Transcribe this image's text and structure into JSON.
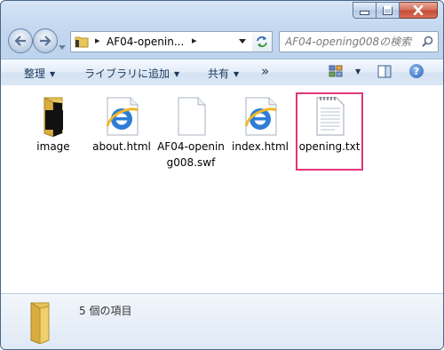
{
  "window": {
    "buttons": [
      "minimize-button",
      "maximize-button",
      "close-button"
    ]
  },
  "nav": {
    "breadcrumb_arrow_1": "▸",
    "path_label": "AF04-openin...",
    "breadcrumb_arrow_2": "▸",
    "search_placeholder": "AF04-opening008の検索"
  },
  "toolbar": {
    "organize": "整理",
    "add_to_library": "ライブラリに追加",
    "share": "共有",
    "more": "»"
  },
  "files": [
    {
      "label": "image",
      "icon": "folder-icon"
    },
    {
      "label": "about.html",
      "icon": "ie-icon"
    },
    {
      "label": "AF04-opening008.swf",
      "icon": "blank-file-icon"
    },
    {
      "label": "index.html",
      "icon": "ie-icon"
    },
    {
      "label": "opening.txt",
      "icon": "text-file-icon"
    }
  ],
  "details": {
    "status": "5 個の項目"
  },
  "colors": {
    "selection_border": "#e2357a",
    "toolbar_text": "#1e395b"
  }
}
